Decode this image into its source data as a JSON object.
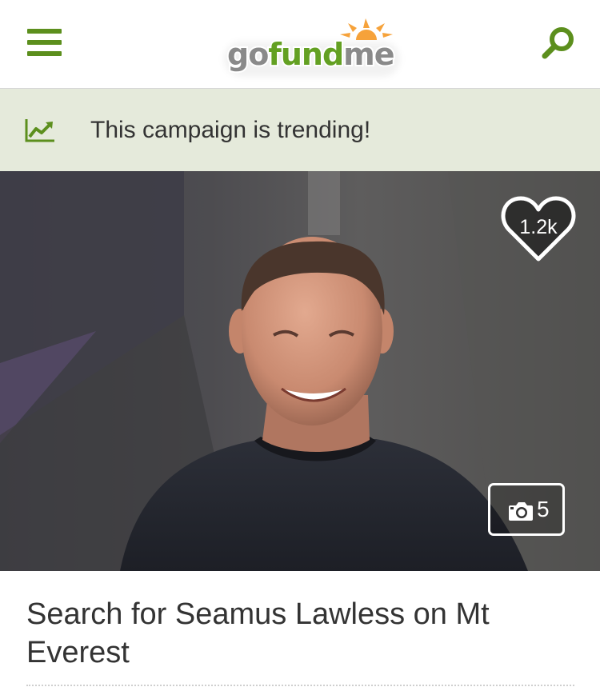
{
  "header": {
    "logo": {
      "part1": "go",
      "part2": "fund",
      "part3": "me"
    },
    "menu_icon": "hamburger-menu-icon",
    "search_icon": "search-icon",
    "brand_color": "#5c8f1d"
  },
  "trending_banner": {
    "icon": "trending-up-chart-icon",
    "text": "This campaign is trending!",
    "background": "#e5eadb"
  },
  "hero": {
    "image": "campaign-photo-smiling-man",
    "likes": {
      "icon": "heart-icon",
      "count": "1.2k"
    },
    "photos": {
      "icon": "camera-icon",
      "count": "5"
    }
  },
  "campaign": {
    "title": "Search for Seamus Lawless on Mt Everest"
  }
}
